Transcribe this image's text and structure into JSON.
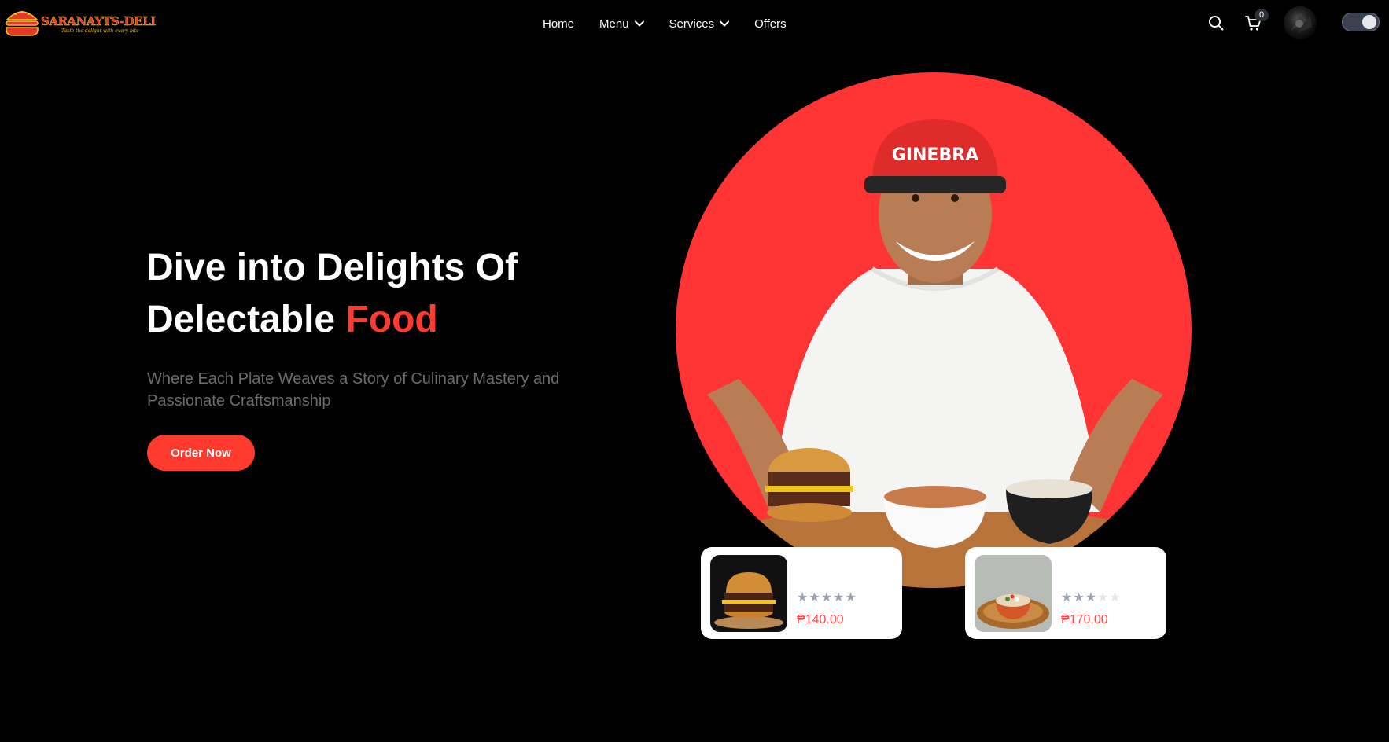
{
  "brand": {
    "name": "SARANAYTS-DELI",
    "tagline": "Taste the delight with every bite"
  },
  "nav": {
    "items": [
      {
        "label": "Home",
        "has_dropdown": false
      },
      {
        "label": "Menu",
        "has_dropdown": true
      },
      {
        "label": "Services",
        "has_dropdown": true
      },
      {
        "label": "Offers",
        "has_dropdown": false
      }
    ]
  },
  "header_actions": {
    "search_icon": "search-icon",
    "cart_icon": "cart-icon",
    "cart_count": "0",
    "theme_toggle": "on"
  },
  "hero": {
    "title_line1": "Dive into Delights Of",
    "title_line2_prefix": "Delectable ",
    "title_accent": "Food",
    "subtitle": "Where Each Plate Weaves a Story of Culinary Mastery and Passionate Craftsmanship",
    "cta_label": "Order Now"
  },
  "products": [
    {
      "rating": 5,
      "max_rating": 5,
      "price": "₱140.00",
      "image": "burger-icon"
    },
    {
      "rating": 3,
      "max_rating": 5,
      "price": "₱170.00",
      "image": "salad-bowl-icon"
    }
  ],
  "colors": {
    "accent": "#ff3b30",
    "hero_circle": "#ff3535",
    "background": "#000000",
    "price": "#ff4b4b",
    "star_filled": "#9aa3ae",
    "star_empty": "#e5e7eb"
  }
}
